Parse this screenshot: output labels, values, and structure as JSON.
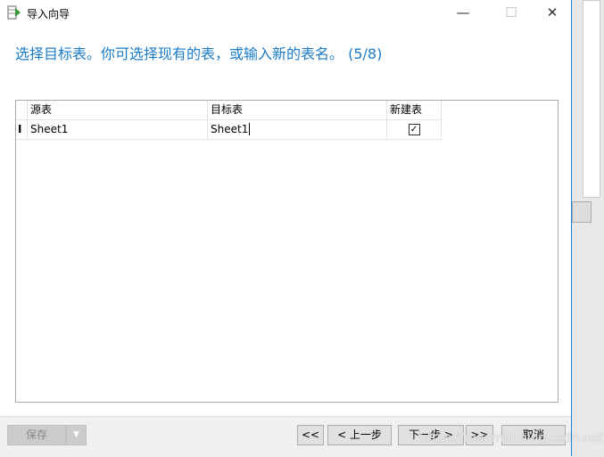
{
  "window": {
    "title": "导入向导",
    "minimize": "—",
    "maximize": "☐",
    "close": "✕"
  },
  "heading": "选择目标表。你可选择现有的表，或输入新的表名。 (5/8)",
  "grid": {
    "columns": [
      "源表",
      "目标表",
      "新建表"
    ],
    "rows": [
      {
        "indicator": "I",
        "source": "Sheet1",
        "target": "Sheet1",
        "new_table": true,
        "check": "✓"
      }
    ]
  },
  "footer": {
    "save": "保存",
    "save_dropdown": "▼",
    "first": "<<",
    "prev": "< 上一步",
    "next": "下一步 >",
    "last": ">>",
    "cancel": "取消"
  },
  "watermark": "https://maomin.blog.csdn.net"
}
